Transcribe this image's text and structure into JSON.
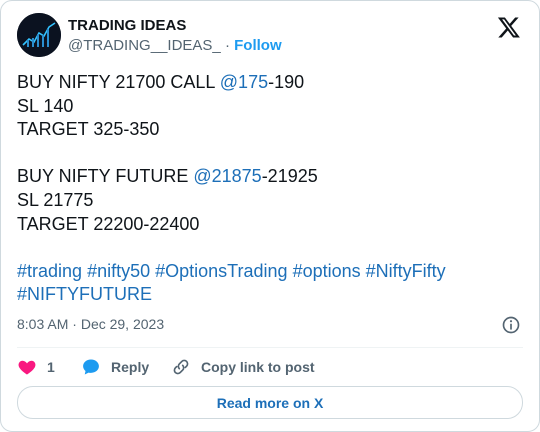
{
  "author": {
    "name": "TRADING IDEAS",
    "handle": "@TRADING__IDEAS_",
    "separator": "·",
    "follow_label": "Follow"
  },
  "tweet": {
    "l1_pre": "BUY NIFTY 21700 CALL ",
    "l1_link": "@175",
    "l1_post": "-190",
    "l2": "SL 140",
    "l3": "TARGET 325-350",
    "l4_pre": "BUY NIFTY FUTURE ",
    "l4_link": "@21875",
    "l4_post": "-21925",
    "l5": "SL 21775",
    "l6": "TARGET 22200-22400",
    "hashtags_line1": [
      "#trading",
      "#nifty50",
      "#OptionsTrading",
      "#options",
      "#NiftyFifty"
    ],
    "hashtags_line2": [
      "#NIFTYFUTURE"
    ]
  },
  "meta": {
    "time": "8:03 AM",
    "separator": "·",
    "date": "Dec 29, 2023"
  },
  "actions": {
    "like_count": "1",
    "reply_label": "Reply",
    "copy_label": "Copy link to post"
  },
  "read_more_label": "Read more on X",
  "icons": {
    "x_logo": "x-logo-icon",
    "info": "info-icon",
    "heart": "heart-icon",
    "reply": "speech-bubble-icon",
    "link": "link-icon"
  },
  "colors": {
    "link": "#1d6fb8",
    "heart": "#f91880",
    "reply_bubble": "#1d9bf0",
    "muted": "#536471"
  }
}
